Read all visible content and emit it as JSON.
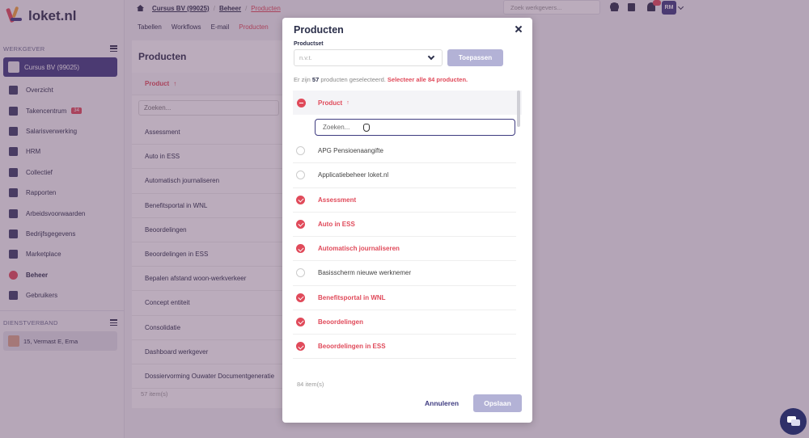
{
  "app": {
    "logo_text": "loket.nl"
  },
  "sidebar": {
    "werkgever_label": "WERKGEVER",
    "company": "Cursus BV (99025)",
    "items": [
      {
        "label": "Overzicht",
        "icon": "clipboard-icon"
      },
      {
        "label": "Takencentrum",
        "icon": "bell-icon",
        "badge": "34"
      },
      {
        "label": "Salarisverwerking",
        "icon": "euro-icon"
      },
      {
        "label": "HRM",
        "icon": "briefcase-icon"
      },
      {
        "label": "Collectief",
        "icon": "collective-icon"
      },
      {
        "label": "Rapporten",
        "icon": "folder-icon"
      },
      {
        "label": "Arbeidsvoorwaarden",
        "icon": "document-icon"
      },
      {
        "label": "Bedrijfsgegevens",
        "icon": "building-icon"
      },
      {
        "label": "Marketplace",
        "icon": "store-icon"
      },
      {
        "label": "Beheer",
        "icon": "gear-icon",
        "active": true
      },
      {
        "label": "Gebruikers",
        "icon": "users-icon"
      }
    ],
    "dienstverband_label": "DIENSTVERBAND",
    "employee": "15, Vermast E, Erna"
  },
  "topbar": {
    "breadcrumb": [
      "Cursus BV (99025)",
      "Beheer",
      "Producten"
    ],
    "search_placeholder": "Zoek werkgevers...",
    "user_initials": "RM"
  },
  "subtabs": [
    "Tabellen",
    "Workflows",
    "E-mail",
    "Producten"
  ],
  "main": {
    "title": "Producten",
    "column": "Product",
    "search_placeholder": "Zoeken...",
    "rows": [
      "Assessment",
      "Auto in ESS",
      "Automatisch journaliseren",
      "Benefitsportal in WNL",
      "Beoordelingen",
      "Beoordelingen in ESS",
      "Bepalen afstand woon-werkverkeer",
      "Concept entiteit",
      "Consolidatie",
      "Dashboard werkgever",
      "Dossiervorming Ouwater Documentgeneratie"
    ],
    "count": "57 item(s)"
  },
  "modal": {
    "title": "Producten",
    "productset_label": "Productset",
    "productset_value": "n.v.t.",
    "apply_label": "Toepassen",
    "selected_prefix": "Er zijn ",
    "selected_count": "57",
    "selected_suffix": " producten geselecteerd. ",
    "select_all": "Selecteer alle 84 producten.",
    "column": "Product",
    "search_placeholder": "Zoeken...",
    "rows": [
      {
        "label": "APG Pensioenaangifte",
        "checked": false
      },
      {
        "label": "Applicatiebeheer loket.nl",
        "checked": false
      },
      {
        "label": "Assessment",
        "checked": true
      },
      {
        "label": "Auto in ESS",
        "checked": true
      },
      {
        "label": "Automatisch journaliseren",
        "checked": true
      },
      {
        "label": "Basisscherm nieuwe werknemer",
        "checked": false
      },
      {
        "label": "Benefitsportal in WNL",
        "checked": true
      },
      {
        "label": "Beoordelingen",
        "checked": true
      },
      {
        "label": "Beoordelingen in ESS",
        "checked": true
      }
    ],
    "count": "84 item(s)",
    "cancel_label": "Annuleren",
    "save_label": "Opslaan"
  }
}
